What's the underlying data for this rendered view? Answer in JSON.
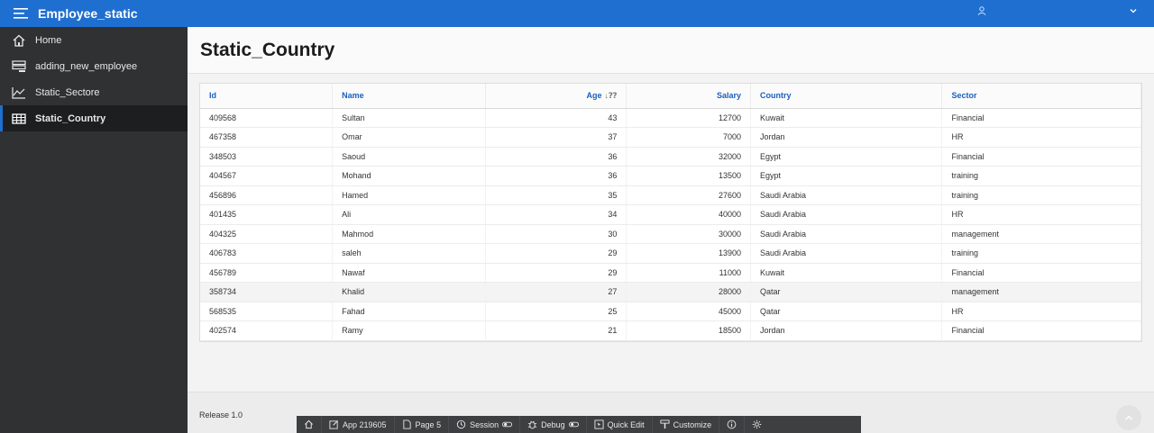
{
  "app": {
    "title": "Employee_static"
  },
  "user": {
    "name": " "
  },
  "sidebar": {
    "items": [
      {
        "label": "Home",
        "icon": "home-icon"
      },
      {
        "label": "adding_new_employee",
        "icon": "form-icon"
      },
      {
        "label": "Static_Sectore",
        "icon": "line-chart-icon"
      },
      {
        "label": "Static_Country",
        "icon": "table-icon"
      }
    ]
  },
  "page": {
    "title": "Static_Country"
  },
  "report": {
    "columns": {
      "id": "Id",
      "name": "Name",
      "age": "Age",
      "salary": "Salary",
      "country": "Country",
      "sector": "Sector"
    },
    "rows": [
      {
        "id": "409568",
        "name": "Sultan",
        "age": "43",
        "salary": "12700",
        "country": "Kuwait",
        "sector": "Financial"
      },
      {
        "id": "467358",
        "name": "Omar",
        "age": "37",
        "salary": "7000",
        "country": "Jordan",
        "sector": "HR"
      },
      {
        "id": "348503",
        "name": "Saoud",
        "age": "36",
        "salary": "32000",
        "country": "Egypt",
        "sector": "Financial"
      },
      {
        "id": "404567",
        "name": "Mohand",
        "age": "36",
        "salary": "13500",
        "country": "Egypt",
        "sector": "training"
      },
      {
        "id": "456896",
        "name": "Hamed",
        "age": "35",
        "salary": "27600",
        "country": "Saudi Arabia",
        "sector": "training"
      },
      {
        "id": "401435",
        "name": "Ali",
        "age": "34",
        "salary": "40000",
        "country": "Saudi Arabia",
        "sector": "HR"
      },
      {
        "id": "404325",
        "name": "Mahmod",
        "age": "30",
        "salary": "30000",
        "country": "Saudi Arabia",
        "sector": "management"
      },
      {
        "id": "406783",
        "name": "saleh",
        "age": "29",
        "salary": "13900",
        "country": "Saudi Arabia",
        "sector": "training"
      },
      {
        "id": "456789",
        "name": "Nawaf",
        "age": "29",
        "salary": "11000",
        "country": "Kuwait",
        "sector": "Financial"
      },
      {
        "id": "358734",
        "name": "Khalid",
        "age": "27",
        "salary": "28000",
        "country": "Qatar",
        "sector": "management"
      },
      {
        "id": "568535",
        "name": "Fahad",
        "age": "25",
        "salary": "45000",
        "country": "Qatar",
        "sector": "HR"
      },
      {
        "id": "402574",
        "name": "Ramy",
        "age": "21",
        "salary": "18500",
        "country": "Jordan",
        "sector": "Financial"
      }
    ]
  },
  "footer": {
    "release": "Release 1.0"
  },
  "devbar": {
    "app": "App 219605",
    "page": "Page 5",
    "session": "Session",
    "debug": "Debug",
    "quick_edit": "Quick Edit",
    "customize": "Customize"
  },
  "colors": {
    "header": "#1f6fd1",
    "sidebar": "#2f3133",
    "link": "#1a5fbf"
  }
}
